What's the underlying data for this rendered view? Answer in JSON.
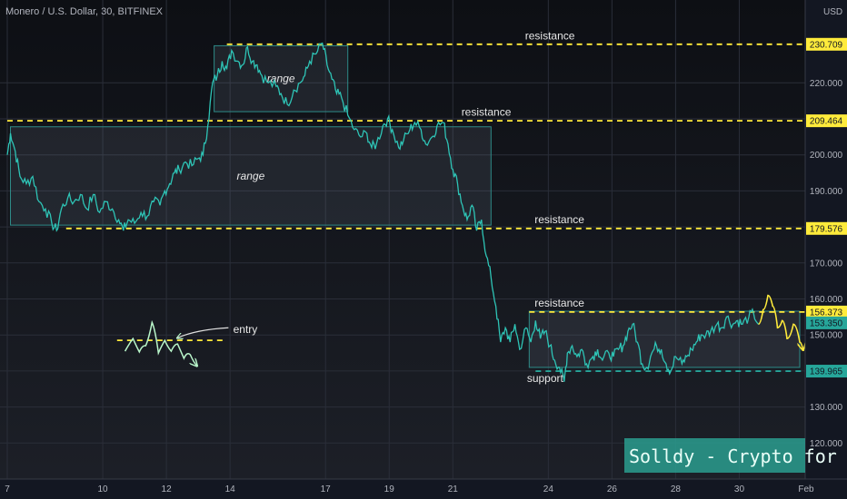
{
  "header": {
    "title": "Monero / U.S. Dollar, 30, BITFINEX"
  },
  "chart_data": {
    "type": "line",
    "symbol": "Monero / U.S. Dollar",
    "timeframe": "30",
    "exchange": "BITFINEX",
    "currency": "USD",
    "ylim": [
      110,
      243
    ],
    "xlim": [
      7,
      32.3
    ],
    "grid": true,
    "yticks": [
      120,
      130,
      140,
      150,
      160,
      170,
      180,
      190,
      200,
      210,
      220
    ],
    "xticks": [
      {
        "label": "7",
        "x": 7.0
      },
      {
        "label": "10",
        "x": 10.0
      },
      {
        "label": "12",
        "x": 12.0
      },
      {
        "label": "14",
        "x": 14.0
      },
      {
        "label": "17",
        "x": 17.0
      },
      {
        "label": "19",
        "x": 19.0
      },
      {
        "label": "21",
        "x": 21.0
      },
      {
        "label": "24",
        "x": 24.0
      },
      {
        "label": "26",
        "x": 26.0
      },
      {
        "label": "28",
        "x": 28.0
      },
      {
        "label": "30",
        "x": 30.0
      },
      {
        "label": "Feb",
        "x": 32.1
      }
    ],
    "price_series": {
      "name": "",
      "color": "#2ec4b6",
      "points": [
        [
          7.0,
          200
        ],
        [
          7.1,
          206
        ],
        [
          7.25,
          201
        ],
        [
          7.4,
          194
        ],
        [
          7.6,
          192
        ],
        [
          7.8,
          194
        ],
        [
          8.0,
          187
        ],
        [
          8.2,
          185
        ],
        [
          8.4,
          181
        ],
        [
          8.55,
          179
        ],
        [
          8.7,
          185
        ],
        [
          8.9,
          188
        ],
        [
          9.1,
          187
        ],
        [
          9.3,
          189
        ],
        [
          9.5,
          185
        ],
        [
          9.7,
          189
        ],
        [
          9.9,
          184
        ],
        [
          10.1,
          187
        ],
        [
          10.3,
          185
        ],
        [
          10.5,
          182
        ],
        [
          10.65,
          179
        ],
        [
          10.8,
          182
        ],
        [
          11.0,
          181
        ],
        [
          11.2,
          184
        ],
        [
          11.4,
          183
        ],
        [
          11.6,
          187
        ],
        [
          11.8,
          186
        ],
        [
          11.95,
          190
        ],
        [
          12.1,
          192
        ],
        [
          12.25,
          195
        ],
        [
          12.4,
          196
        ],
        [
          12.6,
          198
        ],
        [
          12.8,
          197
        ],
        [
          13.0,
          199
        ],
        [
          13.15,
          200
        ],
        [
          13.3,
          208
        ],
        [
          13.45,
          220
        ],
        [
          13.6,
          222
        ],
        [
          13.75,
          226
        ],
        [
          13.9,
          224
        ],
        [
          14.05,
          229
        ],
        [
          14.25,
          226
        ],
        [
          14.4,
          225
        ],
        [
          14.55,
          230
        ],
        [
          14.7,
          226
        ],
        [
          14.85,
          225
        ],
        [
          15.0,
          222
        ],
        [
          15.2,
          220
        ],
        [
          15.45,
          219
        ],
        [
          15.6,
          217
        ],
        [
          15.8,
          214
        ],
        [
          16.0,
          218
        ],
        [
          16.2,
          220
        ],
        [
          16.35,
          222
        ],
        [
          16.5,
          226
        ],
        [
          16.7,
          228
        ],
        [
          16.9,
          231
        ],
        [
          17.05,
          225
        ],
        [
          17.2,
          221
        ],
        [
          17.35,
          217
        ],
        [
          17.5,
          216
        ],
        [
          17.7,
          211
        ],
        [
          17.9,
          207
        ],
        [
          18.1,
          205
        ],
        [
          18.3,
          206
        ],
        [
          18.45,
          202
        ],
        [
          18.6,
          203
        ],
        [
          18.8,
          208
        ],
        [
          18.95,
          210
        ],
        [
          19.1,
          207
        ],
        [
          19.3,
          202
        ],
        [
          19.45,
          204
        ],
        [
          19.65,
          207
        ],
        [
          19.8,
          209
        ],
        [
          20.0,
          207
        ],
        [
          20.15,
          203
        ],
        [
          20.35,
          205
        ],
        [
          20.5,
          208
        ],
        [
          20.7,
          209
        ],
        [
          20.85,
          203
        ],
        [
          21.0,
          196
        ],
        [
          21.15,
          192
        ],
        [
          21.3,
          186
        ],
        [
          21.45,
          182
        ],
        [
          21.6,
          186
        ],
        [
          21.75,
          179
        ],
        [
          21.9,
          182
        ],
        [
          22.05,
          172
        ],
        [
          22.2,
          166
        ],
        [
          22.35,
          158
        ],
        [
          22.5,
          148
        ],
        [
          22.65,
          152
        ],
        [
          22.8,
          148
        ],
        [
          22.95,
          153
        ],
        [
          23.1,
          146
        ],
        [
          23.3,
          152
        ],
        [
          23.45,
          148
        ],
        [
          23.6,
          154
        ],
        [
          23.75,
          149
        ],
        [
          23.9,
          151
        ],
        [
          24.05,
          147
        ],
        [
          24.2,
          143
        ],
        [
          24.35,
          141
        ],
        [
          24.5,
          137
        ],
        [
          24.6,
          145
        ],
        [
          24.75,
          147
        ],
        [
          24.9,
          144
        ],
        [
          25.05,
          146
        ],
        [
          25.2,
          142
        ],
        [
          25.4,
          144
        ],
        [
          25.55,
          146
        ],
        [
          25.7,
          143
        ],
        [
          25.9,
          145
        ],
        [
          26.05,
          144
        ],
        [
          26.2,
          146
        ],
        [
          26.35,
          147
        ],
        [
          26.5,
          151
        ],
        [
          26.65,
          153
        ],
        [
          26.8,
          148
        ],
        [
          26.95,
          142
        ],
        [
          27.1,
          141
        ],
        [
          27.25,
          145
        ],
        [
          27.4,
          147
        ],
        [
          27.55,
          146
        ],
        [
          27.7,
          142
        ],
        [
          27.85,
          140
        ],
        [
          28.0,
          144
        ],
        [
          28.2,
          142
        ],
        [
          28.35,
          144
        ],
        [
          28.5,
          146
        ],
        [
          28.65,
          148
        ],
        [
          28.8,
          150
        ],
        [
          28.95,
          150
        ],
        [
          29.1,
          151
        ],
        [
          29.3,
          153
        ],
        [
          29.45,
          152
        ],
        [
          29.6,
          155
        ],
        [
          29.8,
          153
        ],
        [
          29.95,
          154
        ],
        [
          30.1,
          153
        ],
        [
          30.3,
          155
        ],
        [
          30.45,
          156
        ],
        [
          30.6,
          153
        ]
      ]
    },
    "projection": {
      "color": "#ffeb3b",
      "points": [
        [
          30.6,
          153
        ],
        [
          30.75,
          157
        ],
        [
          30.9,
          161
        ],
        [
          31.05,
          158
        ],
        [
          31.2,
          152
        ],
        [
          31.35,
          154
        ],
        [
          31.5,
          149
        ],
        [
          31.7,
          153
        ],
        [
          31.9,
          148
        ],
        [
          32.0,
          146
        ]
      ]
    },
    "levels": [
      {
        "value": 230.709,
        "label": "230.709",
        "color": "#ffeb3b",
        "x_start": 13.9
      },
      {
        "value": 209.464,
        "label": "209.464",
        "color": "#ffeb3b",
        "x_start": 7.0
      },
      {
        "value": 179.576,
        "label": "179.576",
        "color": "#ffeb3b",
        "x_start": 8.85
      },
      {
        "value": 156.373,
        "label": "156.373",
        "color": "#ffeb3b",
        "x_start": 23.4
      },
      {
        "value": 139.965,
        "label": "139.965",
        "color": "#26a69a",
        "x_start": 23.6
      }
    ],
    "last_price": {
      "value": 153.35,
      "label": "153.350",
      "color": "#26a69a"
    },
    "boxes": [
      {
        "x0": 13.5,
        "x1": 17.7,
        "y0": 212,
        "y1": 230.3,
        "label": "range"
      },
      {
        "x0": 7.1,
        "x1": 22.2,
        "y0": 180.5,
        "y1": 207.8,
        "label": "range"
      },
      {
        "x0": 23.4,
        "x1": 31.9,
        "y0": 141,
        "y1": 156.6,
        "label": ""
      }
    ],
    "annotations": [
      {
        "text": "resistance",
        "x": 24.05,
        "y": 232.0
      },
      {
        "text": "resistance",
        "x": 22.05,
        "y": 210.9
      },
      {
        "text": "resistance",
        "x": 24.35,
        "y": 181.0
      },
      {
        "text": "resistance",
        "x": 24.35,
        "y": 157.8
      },
      {
        "text": "support",
        "x": 23.9,
        "y": 137.0
      },
      {
        "text": "entry",
        "x": 14.1,
        "y": 150.5
      }
    ],
    "entry_sketch": {
      "level": 148.5,
      "x0": 10.45,
      "x1": 13.8,
      "color": "#ffeb3b",
      "wave_color": "#b9f6ca"
    },
    "brand_label": "Solldy - Crypto for U"
  }
}
